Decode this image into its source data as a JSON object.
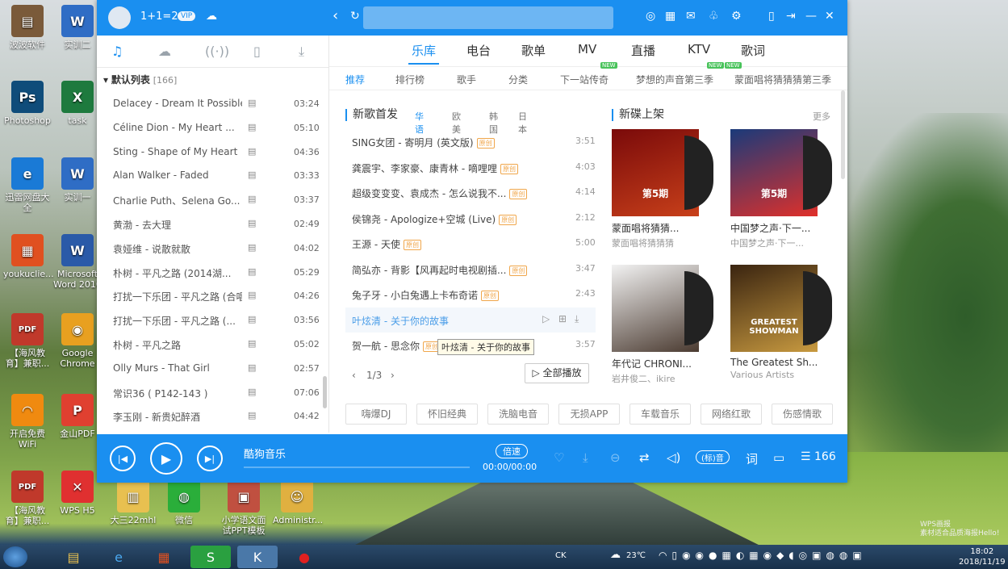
{
  "desktop": {
    "icons": [
      {
        "label": "波波软件",
        "color": "#7a5a3a",
        "glyph": "▤"
      },
      {
        "label": "实训二",
        "color": "#2f6dc5",
        "glyph": "W"
      },
      {
        "label": "Photoshop",
        "color": "#0f4c7a",
        "glyph": "Ps"
      },
      {
        "label": "task",
        "color": "#1e7a3e",
        "glyph": "X"
      },
      {
        "label": "迅雷网盘大全",
        "color": "#1a7ad6",
        "glyph": "e"
      },
      {
        "label": "实训一",
        "color": "#2f6dc5",
        "glyph": "W"
      },
      {
        "label": "youkuclie...",
        "color": "#e05020",
        "glyph": "▦"
      },
      {
        "label": "Microsoft Word 2010",
        "color": "#2a5aa8",
        "glyph": "W"
      },
      {
        "label": "【海风教育】兼职...",
        "color": "#c0392b",
        "glyph": "PDF"
      },
      {
        "label": "Google Chrome",
        "color": "#e8a020",
        "glyph": "◉"
      },
      {
        "label": "开启免费WiFi",
        "color": "#f08a10",
        "glyph": "◠"
      },
      {
        "label": "金山PDF",
        "color": "#e04030",
        "glyph": "P"
      },
      {
        "label": "【海风教育】兼职...",
        "color": "#c0392b",
        "glyph": "PDF"
      },
      {
        "label": "WPS H5",
        "color": "#e03030",
        "glyph": "✕"
      },
      {
        "label": "大三22mhl",
        "color": "#e8c050",
        "glyph": "▥"
      },
      {
        "label": "微信",
        "color": "#2aae3a",
        "glyph": "◍"
      },
      {
        "label": "小学语文面试PPT模板",
        "color": "#c05040",
        "glyph": "▣"
      },
      {
        "label": "Administr...",
        "color": "#e0b040",
        "glyph": "☺"
      }
    ]
  },
  "app": {
    "title": {
      "username": "1+1=2",
      "vip": "VIP"
    },
    "left": {
      "playlist_header": "默认列表",
      "playlist_count": "[166]",
      "songs": [
        {
          "title": "Delacey - Dream It Possible",
          "dur": "03:24"
        },
        {
          "title": "Céline Dion - My Heart ...",
          "dur": "05:10"
        },
        {
          "title": "Sting - Shape of My Heart",
          "dur": "04:36"
        },
        {
          "title": "Alan Walker - Faded",
          "dur": "03:33"
        },
        {
          "title": "Charlie Puth、Selena Go...",
          "dur": "03:37"
        },
        {
          "title": "黄渤 - 去大理",
          "dur": "02:49"
        },
        {
          "title": "袁娅维 - 说散就散",
          "dur": "04:02"
        },
        {
          "title": "朴树 - 平凡之路 (2014湖...",
          "dur": "05:29"
        },
        {
          "title": "打扰一下乐团 - 平凡之路 (合唱...",
          "dur": "04:26"
        },
        {
          "title": "打扰一下乐团 - 平凡之路 (...",
          "dur": "03:56"
        },
        {
          "title": "朴树 - 平凡之路",
          "dur": "05:02"
        },
        {
          "title": "Olly Murs - That Girl",
          "dur": "02:57"
        },
        {
          "title": "常识36 ( P142-143 )",
          "dur": "07:06"
        },
        {
          "title": "李玉刚 - 新贵妃醉酒",
          "dur": "04:42"
        }
      ]
    },
    "main_tabs": [
      "乐库",
      "电台",
      "歌单",
      "MV",
      "直播",
      "KTV",
      "歌词"
    ],
    "sub_tabs": [
      "推荐",
      "排行榜",
      "歌手",
      "分类",
      "下一站传奇",
      "梦想的声音第三季",
      "蒙面唱将猜猜猜第三季"
    ],
    "new_badge": "NEW",
    "new_songs": {
      "title": "新歌首发",
      "langs": [
        "华语",
        "欧美",
        "韩国",
        "日本"
      ],
      "badge": "原创",
      "items": [
        {
          "title": "SING女团 - 寄明月 (英文版)",
          "dur": "3:51"
        },
        {
          "title": "龚震宇、李家豪、康青林 - 嘀哩哩",
          "dur": "4:03"
        },
        {
          "title": "超级变变变、袁成杰 - 怎么说我不...",
          "dur": "4:14"
        },
        {
          "title": "侯锦尧 - Apologize+空城 (Live)",
          "dur": "2:12"
        },
        {
          "title": "王源 - 天使",
          "dur": "5:00"
        },
        {
          "title": "简弘亦 - 背影【风再起时电视剧插...",
          "dur": "3:47"
        },
        {
          "title": "兔子牙 - 小白兔遇上卡布奇诺",
          "dur": "2:43"
        },
        {
          "title": "叶炫清 - 关于你的故事",
          "dur": ""
        },
        {
          "title": "贺一航 - 思念你",
          "dur": "3:57"
        }
      ],
      "tooltip": "叶炫清 - 关于你的故事",
      "pager": "1/3",
      "play_all": "全部播放"
    },
    "new_albums": {
      "title": "新碟上架",
      "more": "更多",
      "items": [
        {
          "name": "蒙面唱将猜猜...",
          "artist": "蒙面唱将猜猜猜",
          "color1": "#7a0a0a",
          "color2": "#c8401a",
          "label": "第5期"
        },
        {
          "name": "中国梦之声·下一...",
          "artist": "中国梦之声·下一...",
          "color1": "#1a3a7a",
          "color2": "#e0302a",
          "label": "第5期"
        },
        {
          "name": "年代记 CHRONI...",
          "artist": "岩井俊二、ikire",
          "color1": "#f2f2f2",
          "color2": "#4a3a30",
          "label": ""
        },
        {
          "name": "The Greatest Sh...",
          "artist": "Various Artists",
          "color1": "#3a2410",
          "color2": "#c89a40",
          "label": "GREATEST SHOWMAN"
        }
      ]
    },
    "tags": [
      "嗨爆DJ",
      "怀旧经典",
      "洗脑电音",
      "无损APP",
      "车载音乐",
      "网络红歌",
      "伤感情歌"
    ],
    "player": {
      "title": "酷狗音乐",
      "speed": "倍速",
      "time": "00:00/00:00",
      "quality": "(标)音",
      "lyric": "词",
      "count": "166"
    }
  },
  "taskbar": {
    "clock_time": "18:02",
    "clock_date": "2018/11/19",
    "weather": "23℃",
    "lang": "CK"
  },
  "watermark": {
    "line1": "WPS画报",
    "line2": "素材适合品质海报Hello!"
  }
}
